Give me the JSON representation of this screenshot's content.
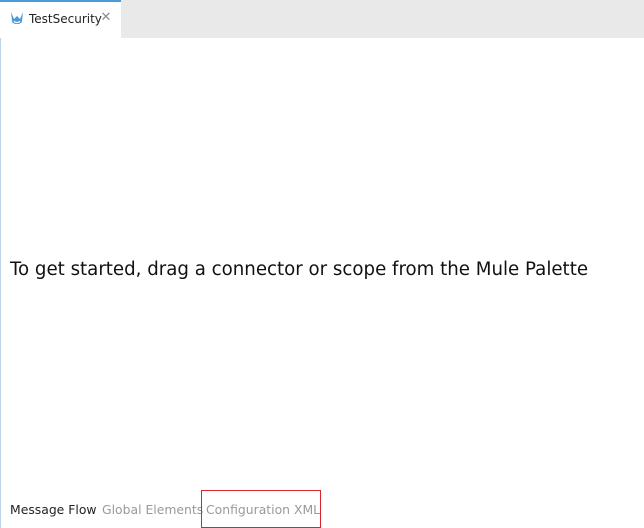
{
  "editor": {
    "tab": {
      "label": "TestSecurity",
      "close": "✕",
      "icon": "mule-flow-icon"
    },
    "hint": "To get started, drag a connector or scope from the Mule Palette"
  },
  "bottom_tabs": [
    {
      "label": "Message Flow",
      "state": "active"
    },
    {
      "label": "Global Elements",
      "state": "inactive"
    },
    {
      "label": "Configuration XML",
      "state": "inactive",
      "highlighted": true
    }
  ],
  "colors": {
    "accent": "#4a9ad8",
    "highlight_border": "#d9252b",
    "inactive_text": "#9a9a9a"
  }
}
